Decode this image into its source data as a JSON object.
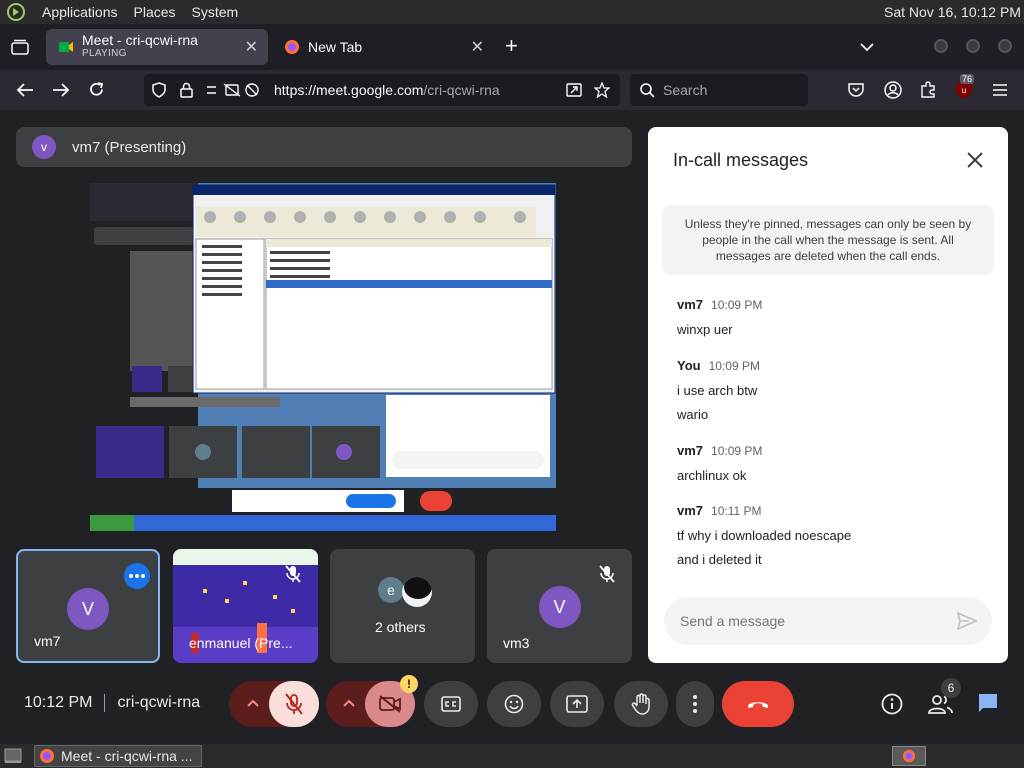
{
  "system_bar": {
    "menu": [
      "Applications",
      "Places",
      "System"
    ],
    "clock": "Sat Nov 16, 10:12 PM"
  },
  "browser": {
    "tabs": [
      {
        "title": "Meet - cri-qcwi-rna",
        "status": "PLAYING"
      },
      {
        "title": "New Tab"
      }
    ],
    "url_host": "https://meet.google.com",
    "url_path": "/cri-qcwi-rna",
    "search_placeholder": "Search",
    "extension_badge": "76"
  },
  "meet": {
    "presenter_initial": "v",
    "presenter_label": "vm7 (Presenting)",
    "tiles": [
      {
        "name": "vm7",
        "initial": "V"
      },
      {
        "name": "enmanuel (Pre..."
      },
      {
        "name": "2 others",
        "initial": "e"
      },
      {
        "name": "vm3",
        "initial": "V"
      }
    ],
    "time": "10:12 PM",
    "meeting_code": "cri-qcwi-rna",
    "people_count": "6",
    "warning_badge": "!"
  },
  "chat": {
    "title": "In-call messages",
    "notice": "Unless they're pinned, messages can only be seen by people in the call when the message is sent. All messages are deleted when the call ends.",
    "messages": [
      {
        "sender": "vm7",
        "time": "10:09 PM",
        "lines": [
          "winxp uer"
        ]
      },
      {
        "sender": "You",
        "time": "10:09 PM",
        "lines": [
          "i use arch btw",
          "wario"
        ]
      },
      {
        "sender": "vm7",
        "time": "10:09 PM",
        "lines": [
          "archlinux ok"
        ]
      },
      {
        "sender": "vm7",
        "time": "10:11 PM",
        "lines": [
          "tf why i downloaded noescape",
          "and i deleted it"
        ]
      }
    ],
    "placeholder": "Send a message"
  },
  "taskbar": {
    "window_title": "Meet - cri-qcwi-rna ..."
  }
}
